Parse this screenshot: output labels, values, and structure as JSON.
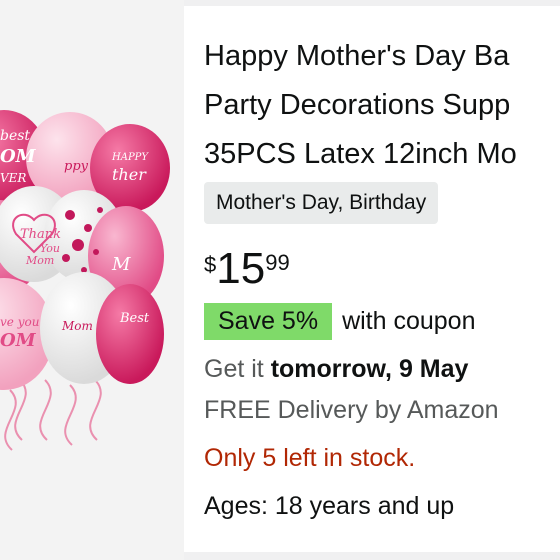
{
  "product": {
    "title_lines": [
      "Happy Mother's Day Ba",
      "Party Decorations Supp",
      "35PCS Latex 12inch Mo"
    ],
    "tag": "Mother's Day, Birthday",
    "price": {
      "symbol": "$",
      "whole": "15",
      "fraction": "99"
    },
    "coupon": {
      "badge": "Save 5%",
      "text": "with coupon"
    },
    "delivery": {
      "prefix": "Get it",
      "date": "tomorrow, 9 May",
      "free_text": "FREE Delivery by Amazon"
    },
    "stock": "Only 5 left in stock.",
    "ages": "Ages: 18 years and up"
  },
  "image": {
    "balloon_texts": [
      "Best MOM EVER",
      "Happy Mother",
      "Happy Mother",
      "Thank You Mom",
      "Love you MOM",
      "Best Mom",
      "Happy Mother's",
      "Mom"
    ]
  },
  "colors": {
    "price_text": "#0f1111",
    "coupon_badge": "#7fda69",
    "stock_text": "#b12704",
    "tag_bg": "#e9ebeb",
    "secondary_text": "#565959"
  }
}
